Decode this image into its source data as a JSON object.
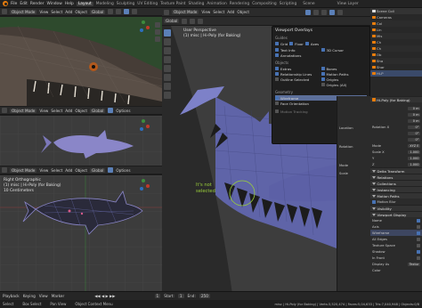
{
  "topbar": {
    "menus": [
      "File",
      "Edit",
      "Render",
      "Window",
      "Help"
    ],
    "workspaces": [
      "Layout",
      "Modeling",
      "Sculpting",
      "UV Editing",
      "Texture Paint",
      "Shading",
      "Animation",
      "Rendering",
      "Compositing",
      "Scripting"
    ],
    "active_workspace": "Layout",
    "scene_label": "Scene",
    "view_layer_label": "View Layer"
  },
  "viewport_header": {
    "mode": "Object Mode",
    "view": "View",
    "select": "Select",
    "add": "Add",
    "object": "Object",
    "orientation": "Global",
    "options": "Options"
  },
  "viewports": {
    "top_left": {
      "label": ""
    },
    "mid_left": {
      "label": ""
    },
    "bottom_left": {
      "line1": "Right Orthographic",
      "line2": "(1) misc | Hi-Poly (for Baking)",
      "line3": "10 Centimeters"
    },
    "main": {
      "line1": "User Perspective",
      "line2": "(1) misc | Hi-Poly (for Baking)"
    }
  },
  "annotation": {
    "line1": "It's not",
    "line2": "selected"
  },
  "overlays": {
    "title": "Viewport Overlays",
    "guides_title": "Guides",
    "guides": [
      {
        "label": "Grid",
        "on": true
      },
      {
        "label": "Floor",
        "on": true
      },
      {
        "label": "Axes",
        "on": true
      }
    ],
    "guides_right": [
      {
        "label": "Text Info",
        "on": true
      },
      {
        "label": "3D Cursor",
        "on": true
      },
      {
        "label": "Annotations",
        "on": true
      }
    ],
    "objects_title": "Objects",
    "objects_left": [
      {
        "label": "Extras",
        "on": true
      },
      {
        "label": "Relationship Lines",
        "on": true
      },
      {
        "label": "Outline Selected",
        "on": false
      }
    ],
    "objects_right": [
      {
        "label": "Bones",
        "on": true
      },
      {
        "label": "Motion Paths",
        "on": true
      },
      {
        "label": "Origins",
        "on": true
      },
      {
        "label": "Origins (All)",
        "on": false
      }
    ],
    "geometry_title": "Geometry",
    "geometry": [
      {
        "label": "Wireframe",
        "on": true,
        "highlight": true
      },
      {
        "label": "Face Orientation",
        "on": false
      }
    ],
    "motion_tracking": "Motion Tracking"
  },
  "outliner": {
    "title": "Scene Coll",
    "items": [
      "Cameras",
      "Col",
      "Lin",
      "Mis",
      "Ch",
      "Ch",
      "Ob",
      "Sha",
      "Shar",
      "Hi-P"
    ]
  },
  "npanel": {
    "rows": [
      "Location",
      "Rotation",
      "Mode",
      "Scale",
      "Dimensions"
    ]
  },
  "properties": {
    "object_name": "Hi-Poly (for Baking)",
    "transform_values": [
      "0 m",
      "0 m",
      "0 m",
      "0°",
      "0°",
      "0°",
      "XYZ E",
      "1.000",
      "1.000",
      "1.000"
    ],
    "transform_labels": [
      "",
      "",
      "",
      "Rotation X",
      "",
      "",
      "Mode",
      "Scale X",
      "Y",
      "Z"
    ],
    "sections": [
      "Delta Transform",
      "Relations",
      "Collections",
      "Instancing",
      "Motion Paths"
    ],
    "motion_blur": "Motion Blur",
    "visibility": "Visibility",
    "viewport_display": "Viewport Display",
    "display_rows": [
      {
        "label": "Name",
        "on": true
      },
      {
        "label": "Axis",
        "on": false
      },
      {
        "label": "Wireframe",
        "on": true
      },
      {
        "label": "All Edges",
        "on": false
      },
      {
        "label": "Texture Space",
        "on": false
      },
      {
        "label": "Shadow",
        "on": true
      },
      {
        "label": "In Front",
        "on": false
      }
    ],
    "display_as_label": "Display As",
    "display_as_value": "Textur",
    "color_label": "Color"
  },
  "timeline": {
    "playback": "Playback",
    "keying": "Keying",
    "view": "View",
    "marker": "Marker",
    "start_label": "Start:",
    "start": "1",
    "end_label": "End:",
    "end": "250",
    "current": "1"
  },
  "status": {
    "select": "Select",
    "box_select": "Box Select",
    "pan_view": "Pan View",
    "context_menu": "Object Context Menu",
    "stats": "misc | Hi-Poly (for Baking) | Verts:3,520,474 | Faces:5,04,633 | Tris:7,040,948 | Objects:0/8"
  },
  "colors": {
    "accent": "#4772b3",
    "mesh_wire": "#6b6fb3",
    "shark_body": "#8a86c8",
    "highlight_green": "#9bd03a",
    "blender_orange": "#e87d0d"
  }
}
